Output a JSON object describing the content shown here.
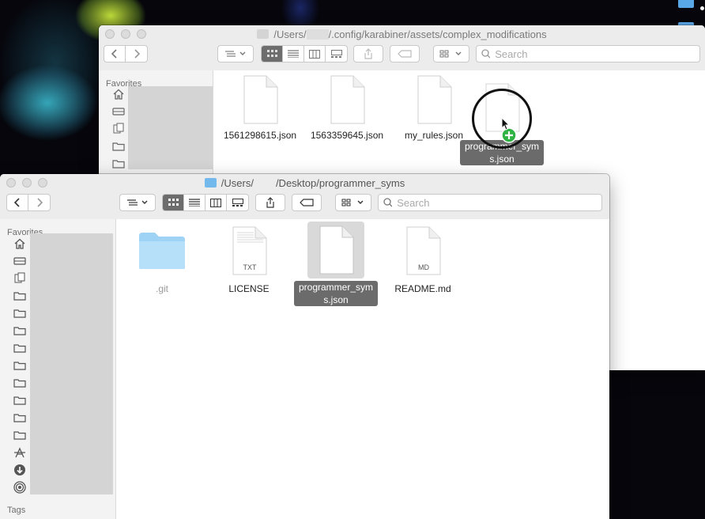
{
  "back_window": {
    "path_prefix": "/Users/",
    "path_suffix": "/.config/karabiner/assets/complex_modifications",
    "search_placeholder": "Search",
    "sidebar_heading": "Favorites",
    "files": [
      {
        "name": "1561298615.json"
      },
      {
        "name": "1563359645.json"
      },
      {
        "name": "my_rules.json"
      }
    ],
    "drag_label": "programmer_sym s.json"
  },
  "front_window": {
    "path_prefix": "/Users/",
    "path_suffix": "/Desktop/programmer_syms",
    "search_placeholder": "Search",
    "sidebar_heading": "Favorites",
    "sidebar_footer": "Tags",
    "files": [
      {
        "name": ".git",
        "kind": "folder"
      },
      {
        "name": "LICENSE",
        "badge": "TXT"
      },
      {
        "name": "programmer_sym s.json",
        "selected": true
      },
      {
        "name": "README.md",
        "badge": "MD"
      }
    ]
  },
  "colors": {
    "folder_blue": "#8fc9ef",
    "selection_gray": "#6b6b6b",
    "drag_plus_green": "#2fb344"
  },
  "icons": [
    "home-icon",
    "drive-icon",
    "documents-icon",
    "folder-icon",
    "applications-icon",
    "downloads-icon",
    "airdrop-icon",
    "share-icon",
    "tag-icon",
    "search-icon"
  ]
}
